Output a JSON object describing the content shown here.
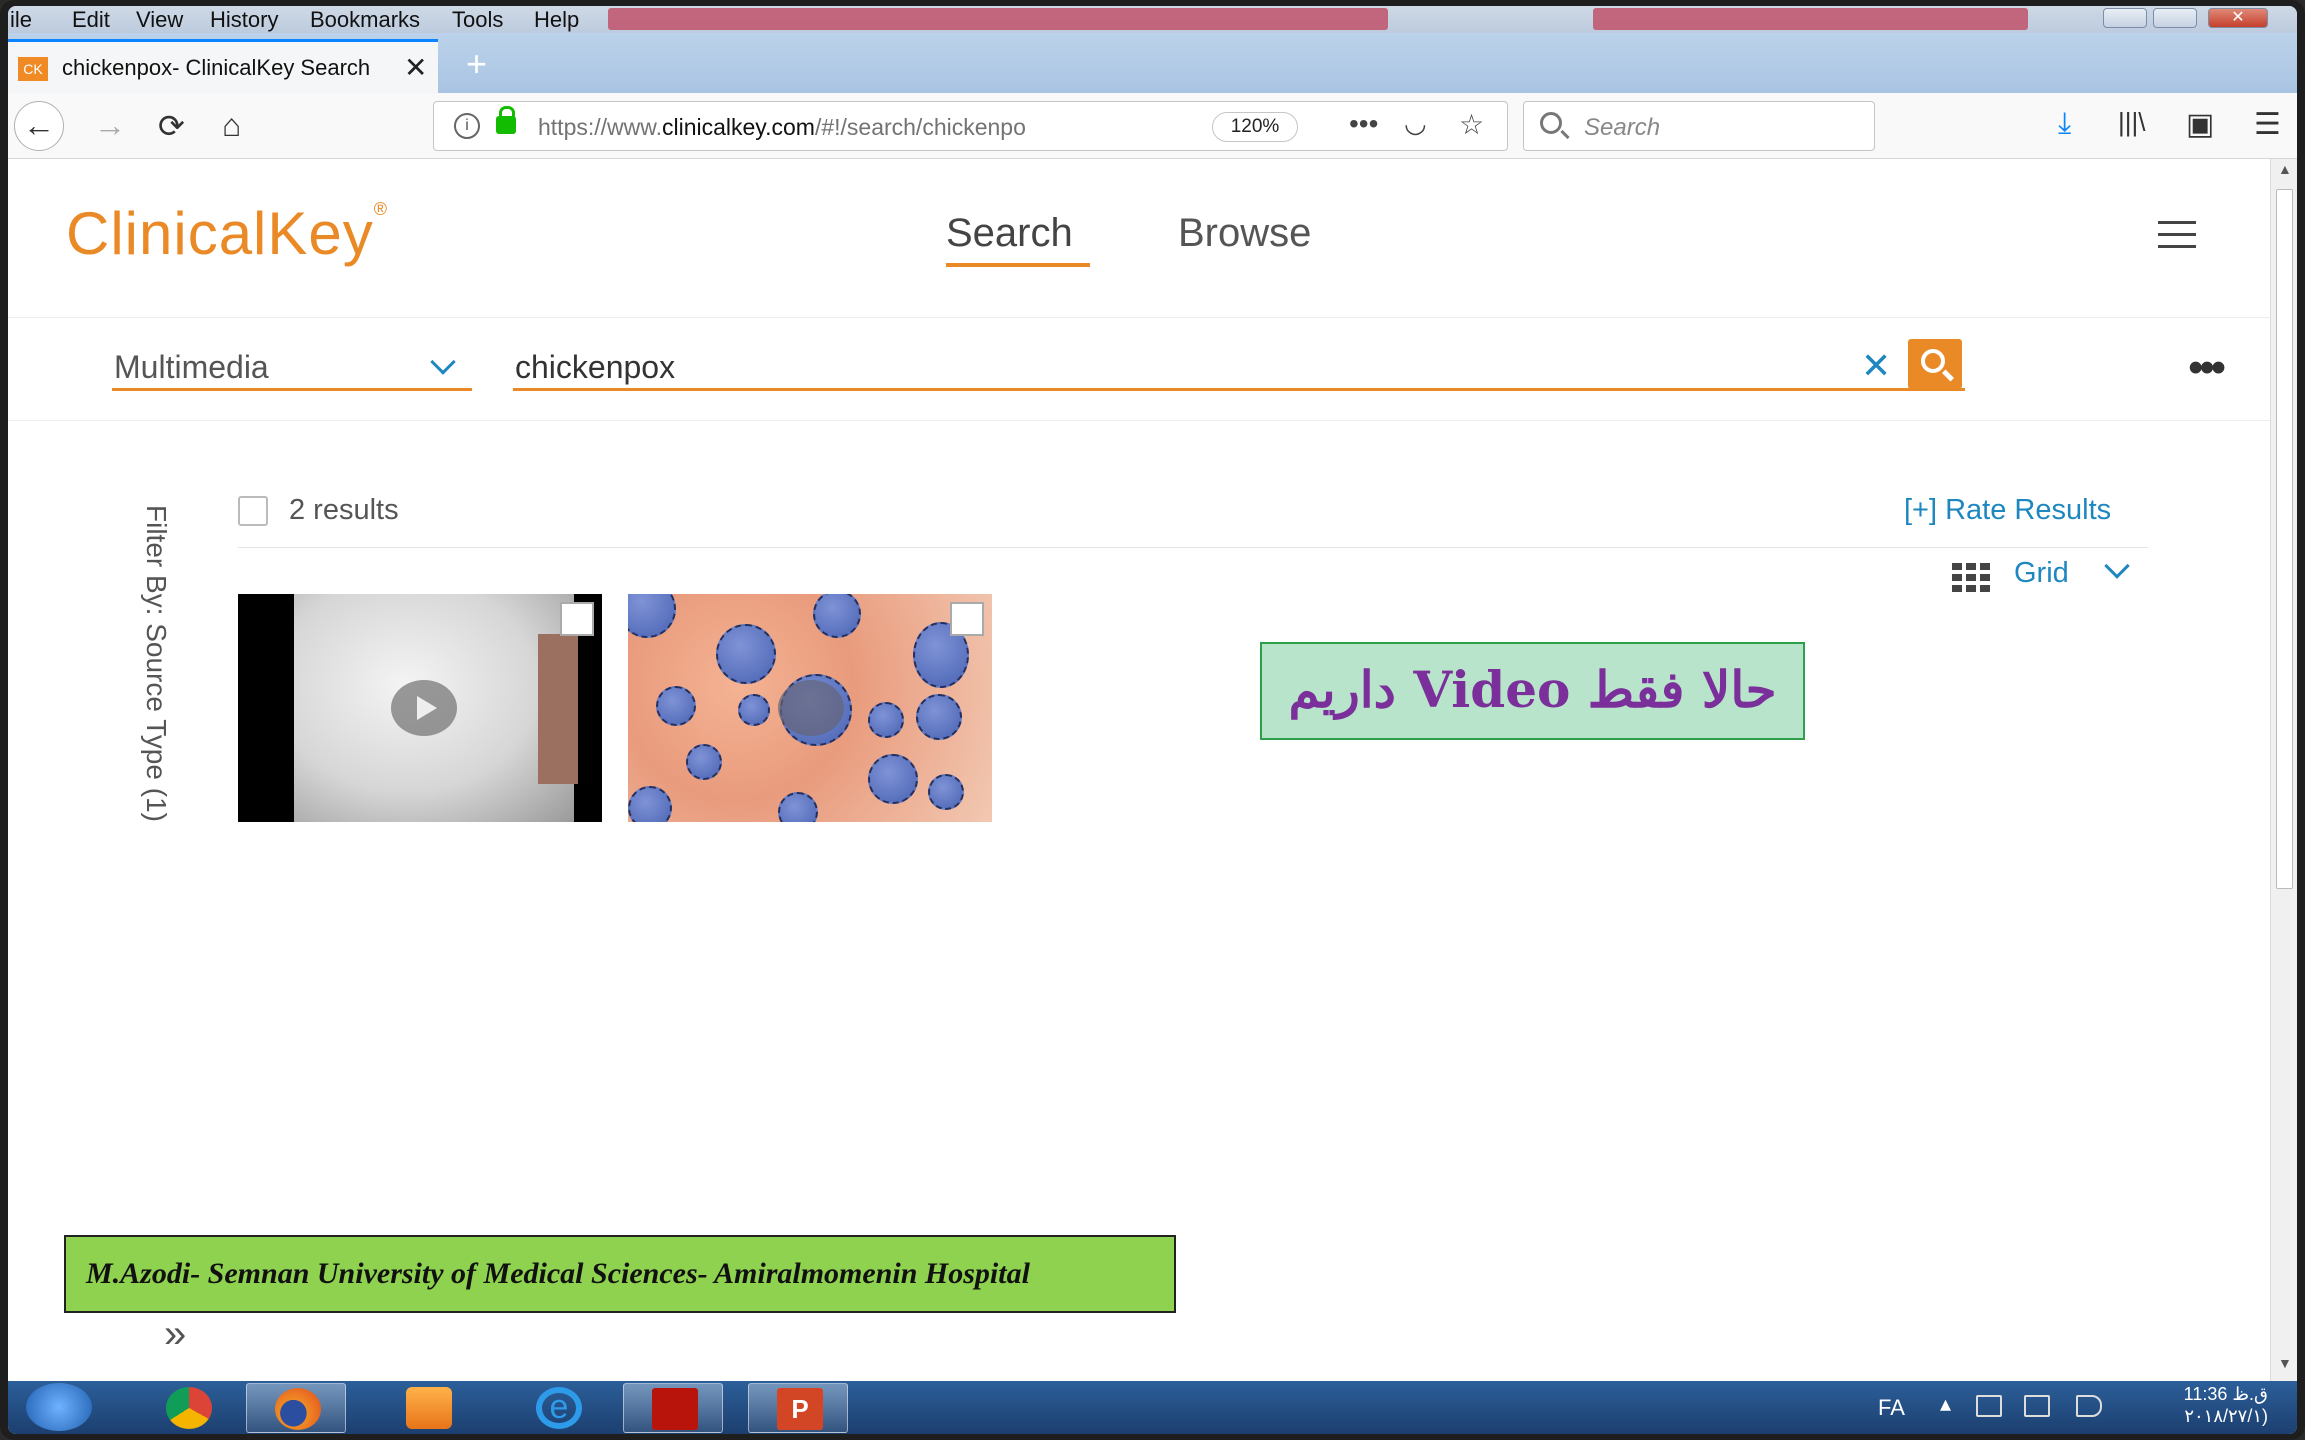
{
  "browser": {
    "menu": [
      "ile",
      "Edit",
      "View",
      "History",
      "Bookmarks",
      "Tools",
      "Help"
    ],
    "tab_title": "chickenpox- ClinicalKey Search",
    "tab_favicon": "CK",
    "url_prefix": "https://www.",
    "url_domain": "clinicalkey.com",
    "url_rest": "/#!/search/chickenpo",
    "zoom": "120%",
    "search_placeholder": "Search"
  },
  "page": {
    "logo": "ClinicalKey",
    "logo_mark": "®",
    "nav_search": "Search",
    "nav_browse": "Browse",
    "category": "Multimedia",
    "query": "chickenpox",
    "clear_symbol": "✕",
    "filter_label": "Filter By: Source Type (1)",
    "results_count": "2 results",
    "rate_results": "[+] Rate Results",
    "view_mode": "Grid"
  },
  "overlay_note": "حالا فقط Video داریم",
  "credit": "M.Azodi- Semnan University of  Medical Sciences- Amiralmomenin Hospital",
  "taskbar": {
    "lang": "FA",
    "time": "11:36 ق.ظ",
    "date": "۲۰۱۸/۲۷/۱)"
  },
  "colors": {
    "brand_orange": "#e98a26",
    "link_blue": "#1e87c0",
    "overlay_text": "#7b2f9a",
    "credit_bg": "#8ed24f"
  }
}
